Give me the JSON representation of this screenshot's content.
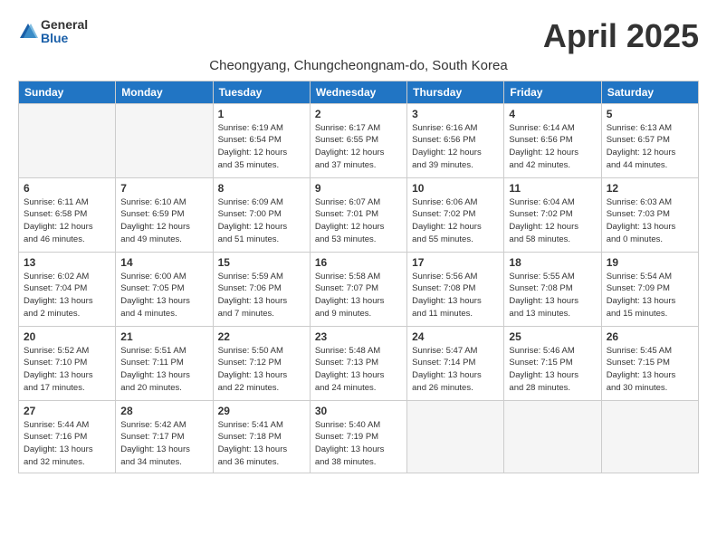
{
  "logo": {
    "general": "General",
    "blue": "Blue"
  },
  "title": "April 2025",
  "location": "Cheongyang, Chungcheongnam-do, South Korea",
  "weekdays": [
    "Sunday",
    "Monday",
    "Tuesday",
    "Wednesday",
    "Thursday",
    "Friday",
    "Saturday"
  ],
  "weeks": [
    [
      {
        "day": "",
        "info": ""
      },
      {
        "day": "",
        "info": ""
      },
      {
        "day": "1",
        "info": "Sunrise: 6:19 AM\nSunset: 6:54 PM\nDaylight: 12 hours\nand 35 minutes."
      },
      {
        "day": "2",
        "info": "Sunrise: 6:17 AM\nSunset: 6:55 PM\nDaylight: 12 hours\nand 37 minutes."
      },
      {
        "day": "3",
        "info": "Sunrise: 6:16 AM\nSunset: 6:56 PM\nDaylight: 12 hours\nand 39 minutes."
      },
      {
        "day": "4",
        "info": "Sunrise: 6:14 AM\nSunset: 6:56 PM\nDaylight: 12 hours\nand 42 minutes."
      },
      {
        "day": "5",
        "info": "Sunrise: 6:13 AM\nSunset: 6:57 PM\nDaylight: 12 hours\nand 44 minutes."
      }
    ],
    [
      {
        "day": "6",
        "info": "Sunrise: 6:11 AM\nSunset: 6:58 PM\nDaylight: 12 hours\nand 46 minutes."
      },
      {
        "day": "7",
        "info": "Sunrise: 6:10 AM\nSunset: 6:59 PM\nDaylight: 12 hours\nand 49 minutes."
      },
      {
        "day": "8",
        "info": "Sunrise: 6:09 AM\nSunset: 7:00 PM\nDaylight: 12 hours\nand 51 minutes."
      },
      {
        "day": "9",
        "info": "Sunrise: 6:07 AM\nSunset: 7:01 PM\nDaylight: 12 hours\nand 53 minutes."
      },
      {
        "day": "10",
        "info": "Sunrise: 6:06 AM\nSunset: 7:02 PM\nDaylight: 12 hours\nand 55 minutes."
      },
      {
        "day": "11",
        "info": "Sunrise: 6:04 AM\nSunset: 7:02 PM\nDaylight: 12 hours\nand 58 minutes."
      },
      {
        "day": "12",
        "info": "Sunrise: 6:03 AM\nSunset: 7:03 PM\nDaylight: 13 hours\nand 0 minutes."
      }
    ],
    [
      {
        "day": "13",
        "info": "Sunrise: 6:02 AM\nSunset: 7:04 PM\nDaylight: 13 hours\nand 2 minutes."
      },
      {
        "day": "14",
        "info": "Sunrise: 6:00 AM\nSunset: 7:05 PM\nDaylight: 13 hours\nand 4 minutes."
      },
      {
        "day": "15",
        "info": "Sunrise: 5:59 AM\nSunset: 7:06 PM\nDaylight: 13 hours\nand 7 minutes."
      },
      {
        "day": "16",
        "info": "Sunrise: 5:58 AM\nSunset: 7:07 PM\nDaylight: 13 hours\nand 9 minutes."
      },
      {
        "day": "17",
        "info": "Sunrise: 5:56 AM\nSunset: 7:08 PM\nDaylight: 13 hours\nand 11 minutes."
      },
      {
        "day": "18",
        "info": "Sunrise: 5:55 AM\nSunset: 7:08 PM\nDaylight: 13 hours\nand 13 minutes."
      },
      {
        "day": "19",
        "info": "Sunrise: 5:54 AM\nSunset: 7:09 PM\nDaylight: 13 hours\nand 15 minutes."
      }
    ],
    [
      {
        "day": "20",
        "info": "Sunrise: 5:52 AM\nSunset: 7:10 PM\nDaylight: 13 hours\nand 17 minutes."
      },
      {
        "day": "21",
        "info": "Sunrise: 5:51 AM\nSunset: 7:11 PM\nDaylight: 13 hours\nand 20 minutes."
      },
      {
        "day": "22",
        "info": "Sunrise: 5:50 AM\nSunset: 7:12 PM\nDaylight: 13 hours\nand 22 minutes."
      },
      {
        "day": "23",
        "info": "Sunrise: 5:48 AM\nSunset: 7:13 PM\nDaylight: 13 hours\nand 24 minutes."
      },
      {
        "day": "24",
        "info": "Sunrise: 5:47 AM\nSunset: 7:14 PM\nDaylight: 13 hours\nand 26 minutes."
      },
      {
        "day": "25",
        "info": "Sunrise: 5:46 AM\nSunset: 7:15 PM\nDaylight: 13 hours\nand 28 minutes."
      },
      {
        "day": "26",
        "info": "Sunrise: 5:45 AM\nSunset: 7:15 PM\nDaylight: 13 hours\nand 30 minutes."
      }
    ],
    [
      {
        "day": "27",
        "info": "Sunrise: 5:44 AM\nSunset: 7:16 PM\nDaylight: 13 hours\nand 32 minutes."
      },
      {
        "day": "28",
        "info": "Sunrise: 5:42 AM\nSunset: 7:17 PM\nDaylight: 13 hours\nand 34 minutes."
      },
      {
        "day": "29",
        "info": "Sunrise: 5:41 AM\nSunset: 7:18 PM\nDaylight: 13 hours\nand 36 minutes."
      },
      {
        "day": "30",
        "info": "Sunrise: 5:40 AM\nSunset: 7:19 PM\nDaylight: 13 hours\nand 38 minutes."
      },
      {
        "day": "",
        "info": ""
      },
      {
        "day": "",
        "info": ""
      },
      {
        "day": "",
        "info": ""
      }
    ]
  ]
}
